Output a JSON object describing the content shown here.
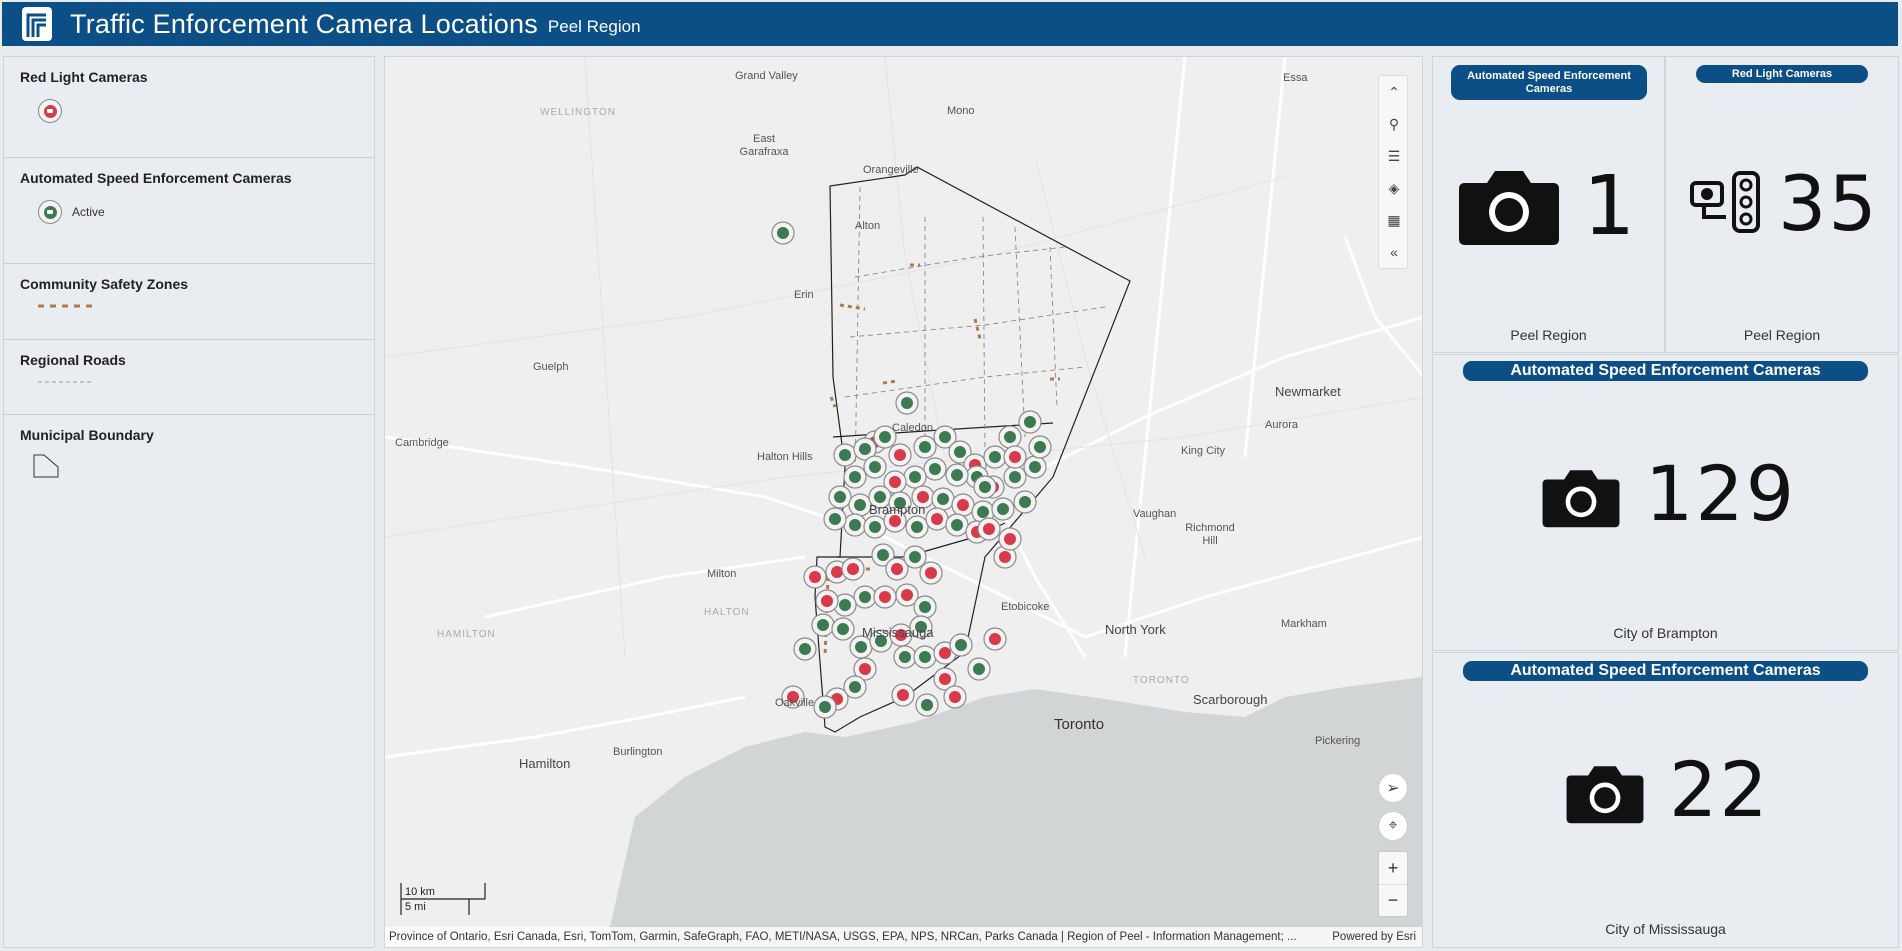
{
  "header": {
    "title": "Traffic Enforcement Camera Locations",
    "subtitle": "Peel Region",
    "logo_icon": "peel-logo-icon"
  },
  "legend": {
    "sections": [
      {
        "title": "Red Light Cameras",
        "items": [
          {
            "label": "",
            "icon": "red-camera-pin-icon",
            "color": "#d93a4a"
          }
        ]
      },
      {
        "title": "Automated Speed Enforcement Cameras",
        "items": [
          {
            "label": "Active",
            "icon": "green-camera-pin-icon",
            "color": "#3d7a52"
          }
        ]
      },
      {
        "title": "Community Safety Zones",
        "items": [
          {
            "label": "",
            "icon": "dashed-brown-line-icon",
            "color": "#b07a4a"
          }
        ]
      },
      {
        "title": "Regional Roads",
        "items": [
          {
            "label": "",
            "icon": "dashed-gray-line-icon",
            "color": "#9a9a9a"
          }
        ]
      },
      {
        "title": "Municipal Boundary",
        "items": [
          {
            "label": "",
            "icon": "polygon-outline-icon",
            "color": "#333333"
          }
        ]
      }
    ]
  },
  "map": {
    "places": [
      {
        "name": "Grand Valley",
        "cls": ""
      },
      {
        "name": "WELLINGTON",
        "cls": "faint"
      },
      {
        "name": "Mono",
        "cls": ""
      },
      {
        "name": "Essa",
        "cls": ""
      },
      {
        "name": "East Garafraxa",
        "cls": ""
      },
      {
        "name": "Orangeville",
        "cls": ""
      },
      {
        "name": "Alton",
        "cls": ""
      },
      {
        "name": "Erin",
        "cls": ""
      },
      {
        "name": "Guelph",
        "cls": ""
      },
      {
        "name": "Newmarket",
        "cls": "mid"
      },
      {
        "name": "Aurora",
        "cls": ""
      },
      {
        "name": "Cambridge",
        "cls": ""
      },
      {
        "name": "Halton Hills",
        "cls": ""
      },
      {
        "name": "Caledon",
        "cls": ""
      },
      {
        "name": "King City",
        "cls": ""
      },
      {
        "name": "Brampton",
        "cls": "mid"
      },
      {
        "name": "Vaughan",
        "cls": ""
      },
      {
        "name": "Richmond Hill",
        "cls": ""
      },
      {
        "name": "Milton",
        "cls": ""
      },
      {
        "name": "HALTON",
        "cls": "faint"
      },
      {
        "name": "Etobicoke",
        "cls": ""
      },
      {
        "name": "North York",
        "cls": "mid"
      },
      {
        "name": "Markham",
        "cls": ""
      },
      {
        "name": "HAMILTON",
        "cls": "faint"
      },
      {
        "name": "Mississauga",
        "cls": "mid"
      },
      {
        "name": "TORONTO",
        "cls": "faint"
      },
      {
        "name": "Scarborough",
        "cls": "mid"
      },
      {
        "name": "Oakville",
        "cls": ""
      },
      {
        "name": "Toronto",
        "cls": "big"
      },
      {
        "name": "Hamilton",
        "cls": "mid"
      },
      {
        "name": "Burlington",
        "cls": ""
      },
      {
        "name": "Pickering",
        "cls": ""
      }
    ],
    "tools": [
      "collapse-up-icon",
      "search-icon",
      "list-icon",
      "layers-icon",
      "qr-code-icon",
      "collapse-left-icon"
    ],
    "scale": {
      "km": "10 km",
      "mi": "5 mi"
    },
    "attribution": "Province of Ontario, Esri Canada, Esri, TomTom, Garmin, SafeGraph, FAO, METI/NASA, USGS, EPA, NPS, NRCan, Parks Canada | Region of Peel - Information Management; ...",
    "powered": "Powered by Esri",
    "zoom_in": "+",
    "zoom_out": "−"
  },
  "indicators": [
    {
      "label": "Automated Speed Enforcement Cameras",
      "value": "1",
      "caption": "Peel Region",
      "icon": "camera-icon"
    },
    {
      "label": "Red Light Cameras",
      "value": "35",
      "caption": "Peel Region",
      "icon": "traffic-light-camera-icon"
    },
    {
      "label": "Automated Speed Enforcement Cameras",
      "value": "129",
      "caption": "City of Brampton",
      "icon": "camera-icon"
    },
    {
      "label": "Automated Speed Enforcement Cameras",
      "value": "22",
      "caption": "City of Mississauga",
      "icon": "camera-icon"
    }
  ],
  "colors": {
    "brand": "#0c4f86",
    "red_pin": "#d93a4a",
    "green_pin": "#3d7a52"
  }
}
